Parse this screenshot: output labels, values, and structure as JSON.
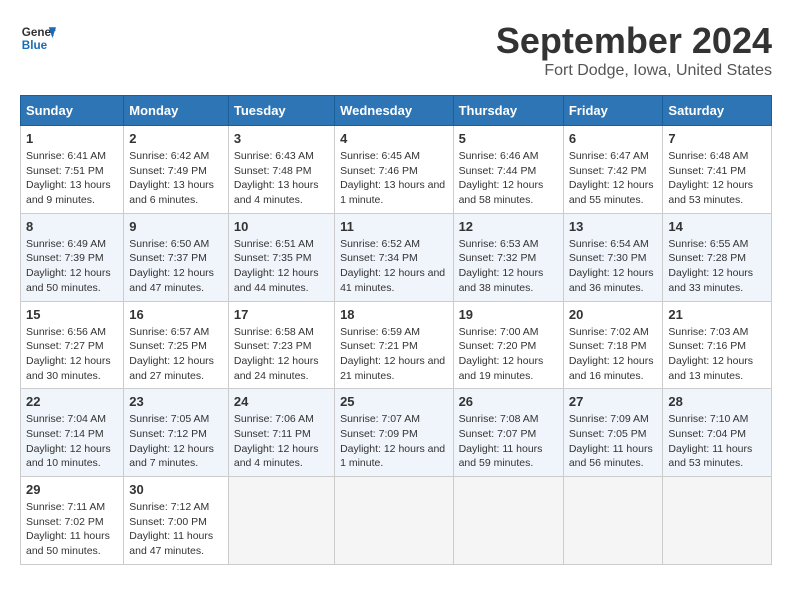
{
  "header": {
    "logo_line1": "General",
    "logo_line2": "Blue",
    "title": "September 2024",
    "location": "Fort Dodge, Iowa, United States"
  },
  "days_of_week": [
    "Sunday",
    "Monday",
    "Tuesday",
    "Wednesday",
    "Thursday",
    "Friday",
    "Saturday"
  ],
  "weeks": [
    [
      {
        "day": "1",
        "sunrise": "6:41 AM",
        "sunset": "7:51 PM",
        "daylight": "13 hours and 9 minutes."
      },
      {
        "day": "2",
        "sunrise": "6:42 AM",
        "sunset": "7:49 PM",
        "daylight": "13 hours and 6 minutes."
      },
      {
        "day": "3",
        "sunrise": "6:43 AM",
        "sunset": "7:48 PM",
        "daylight": "13 hours and 4 minutes."
      },
      {
        "day": "4",
        "sunrise": "6:45 AM",
        "sunset": "7:46 PM",
        "daylight": "13 hours and 1 minute."
      },
      {
        "day": "5",
        "sunrise": "6:46 AM",
        "sunset": "7:44 PM",
        "daylight": "12 hours and 58 minutes."
      },
      {
        "day": "6",
        "sunrise": "6:47 AM",
        "sunset": "7:42 PM",
        "daylight": "12 hours and 55 minutes."
      },
      {
        "day": "7",
        "sunrise": "6:48 AM",
        "sunset": "7:41 PM",
        "daylight": "12 hours and 53 minutes."
      }
    ],
    [
      {
        "day": "8",
        "sunrise": "6:49 AM",
        "sunset": "7:39 PM",
        "daylight": "12 hours and 50 minutes."
      },
      {
        "day": "9",
        "sunrise": "6:50 AM",
        "sunset": "7:37 PM",
        "daylight": "12 hours and 47 minutes."
      },
      {
        "day": "10",
        "sunrise": "6:51 AM",
        "sunset": "7:35 PM",
        "daylight": "12 hours and 44 minutes."
      },
      {
        "day": "11",
        "sunrise": "6:52 AM",
        "sunset": "7:34 PM",
        "daylight": "12 hours and 41 minutes."
      },
      {
        "day": "12",
        "sunrise": "6:53 AM",
        "sunset": "7:32 PM",
        "daylight": "12 hours and 38 minutes."
      },
      {
        "day": "13",
        "sunrise": "6:54 AM",
        "sunset": "7:30 PM",
        "daylight": "12 hours and 36 minutes."
      },
      {
        "day": "14",
        "sunrise": "6:55 AM",
        "sunset": "7:28 PM",
        "daylight": "12 hours and 33 minutes."
      }
    ],
    [
      {
        "day": "15",
        "sunrise": "6:56 AM",
        "sunset": "7:27 PM",
        "daylight": "12 hours and 30 minutes."
      },
      {
        "day": "16",
        "sunrise": "6:57 AM",
        "sunset": "7:25 PM",
        "daylight": "12 hours and 27 minutes."
      },
      {
        "day": "17",
        "sunrise": "6:58 AM",
        "sunset": "7:23 PM",
        "daylight": "12 hours and 24 minutes."
      },
      {
        "day": "18",
        "sunrise": "6:59 AM",
        "sunset": "7:21 PM",
        "daylight": "12 hours and 21 minutes."
      },
      {
        "day": "19",
        "sunrise": "7:00 AM",
        "sunset": "7:20 PM",
        "daylight": "12 hours and 19 minutes."
      },
      {
        "day": "20",
        "sunrise": "7:02 AM",
        "sunset": "7:18 PM",
        "daylight": "12 hours and 16 minutes."
      },
      {
        "day": "21",
        "sunrise": "7:03 AM",
        "sunset": "7:16 PM",
        "daylight": "12 hours and 13 minutes."
      }
    ],
    [
      {
        "day": "22",
        "sunrise": "7:04 AM",
        "sunset": "7:14 PM",
        "daylight": "12 hours and 10 minutes."
      },
      {
        "day": "23",
        "sunrise": "7:05 AM",
        "sunset": "7:12 PM",
        "daylight": "12 hours and 7 minutes."
      },
      {
        "day": "24",
        "sunrise": "7:06 AM",
        "sunset": "7:11 PM",
        "daylight": "12 hours and 4 minutes."
      },
      {
        "day": "25",
        "sunrise": "7:07 AM",
        "sunset": "7:09 PM",
        "daylight": "12 hours and 1 minute."
      },
      {
        "day": "26",
        "sunrise": "7:08 AM",
        "sunset": "7:07 PM",
        "daylight": "11 hours and 59 minutes."
      },
      {
        "day": "27",
        "sunrise": "7:09 AM",
        "sunset": "7:05 PM",
        "daylight": "11 hours and 56 minutes."
      },
      {
        "day": "28",
        "sunrise": "7:10 AM",
        "sunset": "7:04 PM",
        "daylight": "11 hours and 53 minutes."
      }
    ],
    [
      {
        "day": "29",
        "sunrise": "7:11 AM",
        "sunset": "7:02 PM",
        "daylight": "11 hours and 50 minutes."
      },
      {
        "day": "30",
        "sunrise": "7:12 AM",
        "sunset": "7:00 PM",
        "daylight": "11 hours and 47 minutes."
      },
      null,
      null,
      null,
      null,
      null
    ]
  ]
}
